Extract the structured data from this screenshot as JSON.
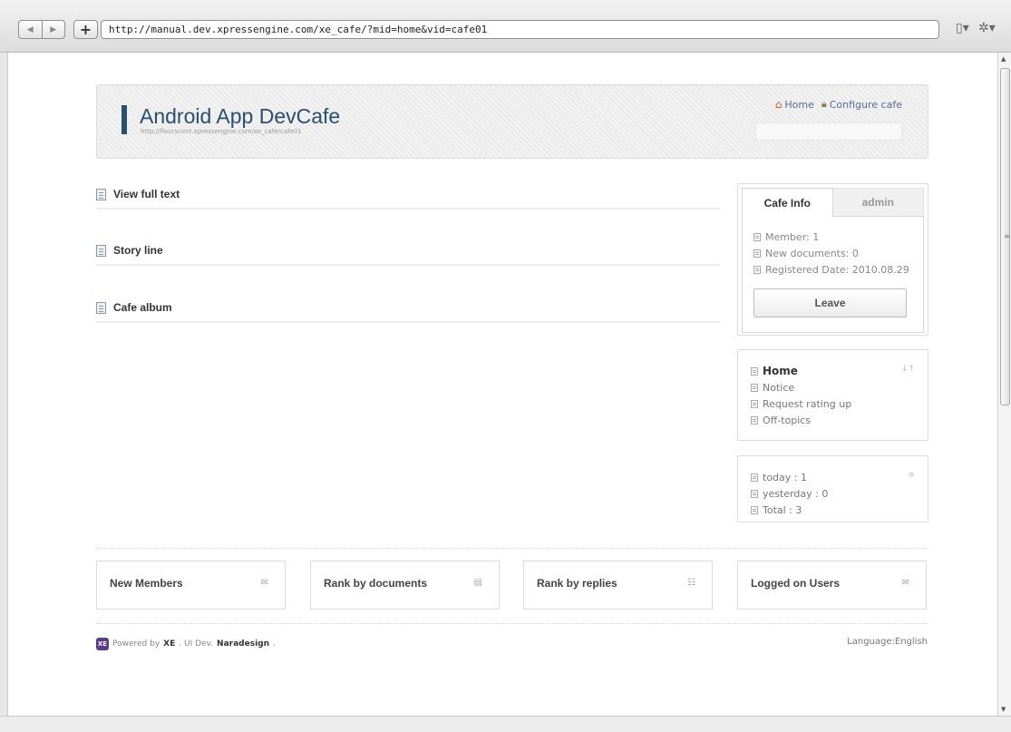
{
  "browser": {
    "url": "http://manual.dev.xpressengine.com/xe_cafe/?mid=home&vid=cafe01"
  },
  "header": {
    "title": "Android App DevCafe",
    "url": "http://flourscent.xpressengine.com/xe_cafe/cafe01",
    "links": {
      "home": "Home",
      "configure": "Configure cafe"
    }
  },
  "main": {
    "sections": [
      "View full text",
      "Story line",
      "Cafe album"
    ]
  },
  "sidebar": {
    "tabs": {
      "active": "Cafe Info",
      "inactive": "admin"
    },
    "info": {
      "member": "Member: 1",
      "new_docs": "New documents: 0",
      "registered": "Registered Date: 2010.08.29"
    },
    "leave_label": "Leave",
    "menu": [
      "Home",
      "Notice",
      "Request rating up",
      "Off-topics"
    ],
    "counter": [
      "today : 1",
      "yesterday : 0",
      "Total : 3"
    ]
  },
  "bottom": {
    "widgets": [
      "New Members",
      "Rank by documents",
      "Rank by replies",
      "Logged on Users"
    ]
  },
  "footer": {
    "logo": "XE",
    "powered_prefix": "Powered by",
    "powered_brand": "XE",
    "ui_prefix": ". UI Dev.",
    "ui_brand": "Naradesign",
    "ui_suffix": ".",
    "language": "Language:English"
  },
  "colors": {
    "title": "#2b4f6e",
    "link": "#5a6aa0",
    "xe_logo": "#5b3b8c"
  }
}
